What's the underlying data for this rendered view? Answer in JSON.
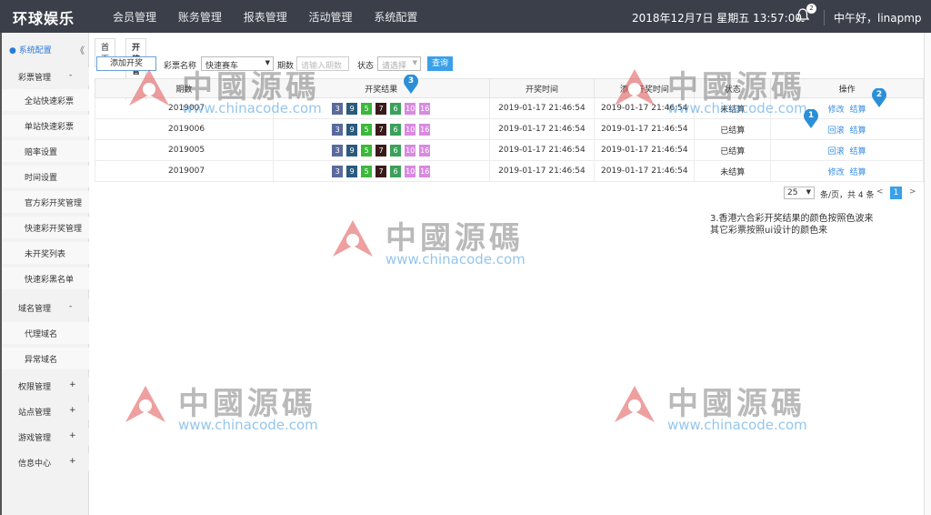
{
  "header": {
    "logo": "环球娱乐",
    "nav": [
      "会员管理",
      "账务管理",
      "报表管理",
      "活动管理",
      "系统配置"
    ],
    "datetime": "2018年12月7日 星期五 13:57:00",
    "notification_count": "2",
    "greeting": "中午好，linapmp"
  },
  "sidebar": {
    "heading": "系统配置",
    "collapse_icon": "《",
    "groups": [
      {
        "label": "彩票管理",
        "sign": "-"
      },
      {
        "label": "域名管理",
        "sign": "-"
      },
      {
        "label": "权限管理",
        "sign": "+"
      },
      {
        "label": "站点管理",
        "sign": "+"
      },
      {
        "label": "游戏管理",
        "sign": "+"
      },
      {
        "label": "信息中心",
        "sign": "+"
      }
    ],
    "lottery_items": [
      "全站快速彩票",
      "单站快速彩票",
      "赔率设置",
      "时间设置",
      "官方彩开奖管理",
      "快速彩开奖管理",
      "未开奖列表",
      "快速彩黑名单"
    ],
    "domain_items": [
      "代理域名",
      "异常域名"
    ]
  },
  "tabs": [
    {
      "label": "首页"
    },
    {
      "label": "开奖管理 x"
    }
  ],
  "toolbar": {
    "add_button": "添加开奖",
    "lottery_label": "彩票名称",
    "lottery_value": "快速赛车",
    "period_label": "期数",
    "period_placeholder": "请输入期数",
    "status_label": "状态",
    "status_value": "请选择",
    "query_button": "查询"
  },
  "table": {
    "columns": [
      "期数",
      "开奖结果",
      "开奖时间",
      "添加开奖时间",
      "状态",
      "操作"
    ],
    "rows": [
      {
        "period": "2019007",
        "balls": [
          "3",
          "9",
          "5",
          "7",
          "6",
          "10",
          "16"
        ],
        "draw_time": "2019-01-17 21:46:54",
        "add_time": "2019-01-17 21:46:54",
        "status": "未结算",
        "status_type": "red",
        "ops": [
          "修改",
          "结算"
        ]
      },
      {
        "period": "2019006",
        "balls": [
          "3",
          "9",
          "5",
          "7",
          "6",
          "10",
          "16"
        ],
        "draw_time": "2019-01-17 21:46:54",
        "add_time": "2019-01-17 21:46:54",
        "status": "已结算",
        "status_type": "green",
        "ops": [
          "回滚",
          "结算"
        ]
      },
      {
        "period": "2019005",
        "balls": [
          "3",
          "9",
          "5",
          "7",
          "6",
          "10",
          "16"
        ],
        "draw_time": "2019-01-17 21:46:54",
        "add_time": "2019-01-17 21:46:54",
        "status": "已结算",
        "status_type": "green",
        "ops": [
          "回滚",
          "结算"
        ]
      },
      {
        "period": "2019007",
        "balls": [
          "3",
          "9",
          "5",
          "7",
          "6",
          "10",
          "16"
        ],
        "draw_time": "2019-01-17 21:46:54",
        "add_time": "2019-01-17 21:46:54",
        "status": "未结算",
        "status_type": "red",
        "ops": [
          "修改",
          "结算"
        ]
      }
    ],
    "ball_colors": [
      "#5a6a9c",
      "#2a5a7c",
      "#3ab83a",
      "#3a1a1a",
      "#3aa05a",
      "#d88ae0",
      "#d88ae0"
    ]
  },
  "pager": {
    "page_size": "25",
    "summary": "条/页，共 4 条",
    "prev": "<",
    "current": "1",
    "next": ">"
  },
  "note": {
    "line1": "3.香港六合彩开奖结果的颜色按照色波来",
    "line2": "其它彩票按照ui设计的颜色来"
  },
  "markers": [
    "3",
    "1",
    "2"
  ],
  "watermark": {
    "text": "中國源碼",
    "url": "www.chinacode.com"
  },
  "colors": {
    "topbar": "#3a3f4a",
    "accent": "#3aa0e8",
    "marker": "#2b8fd8",
    "watermark_logo": "#e05050"
  }
}
